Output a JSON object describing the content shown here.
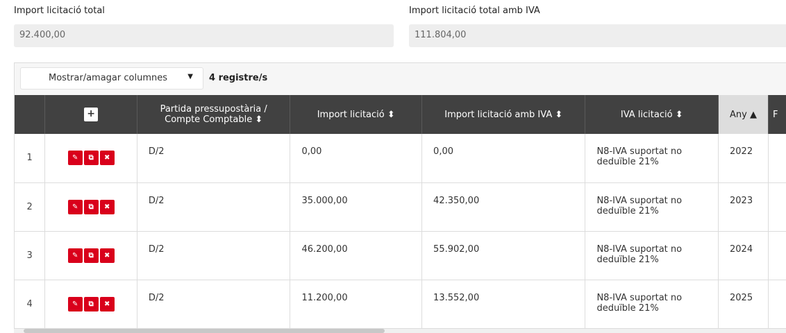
{
  "fields": {
    "total_label": "Import licitació total",
    "total_value": "92.400,00",
    "total_iva_label": "Import licitació total amb IVA",
    "total_iva_value": "111.804,00"
  },
  "toolbar": {
    "columns_dropdown": "Mostrar/amagar columnes",
    "records": "4 registre/s"
  },
  "table": {
    "headers": {
      "add": "+",
      "partida": "Partida pressupostària / Compte Comptable ⬍",
      "import": "Import licitació ⬍",
      "import_iva": "Import licitació amb IVA ⬍",
      "iva": "IVA licitació ⬍",
      "any": "Any ▲",
      "next": "F"
    },
    "rows": [
      {
        "idx": "1",
        "partida": "D/2",
        "import": "0,00",
        "import_iva": "0,00",
        "iva": "N8-IVA suportat no deduïble 21%",
        "any": "2022"
      },
      {
        "idx": "2",
        "partida": "D/2",
        "import": "35.000,00",
        "import_iva": "42.350,00",
        "iva": "N8-IVA suportat no deduïble 21%",
        "any": "2023"
      },
      {
        "idx": "3",
        "partida": "D/2",
        "import": "46.200,00",
        "import_iva": "55.902,00",
        "iva": "N8-IVA suportat no deduïble 21%",
        "any": "2024"
      },
      {
        "idx": "4",
        "partida": "D/2",
        "import": "11.200,00",
        "import_iva": "13.552,00",
        "iva": "N8-IVA suportat no deduïble 21%",
        "any": "2025"
      }
    ]
  },
  "icons": {
    "edit": "✎",
    "copy": "⧉",
    "delete": "✖"
  },
  "colors": {
    "header_bg": "#414141",
    "action_red": "#d9001b",
    "sorted_header_bg": "#dddddd"
  }
}
